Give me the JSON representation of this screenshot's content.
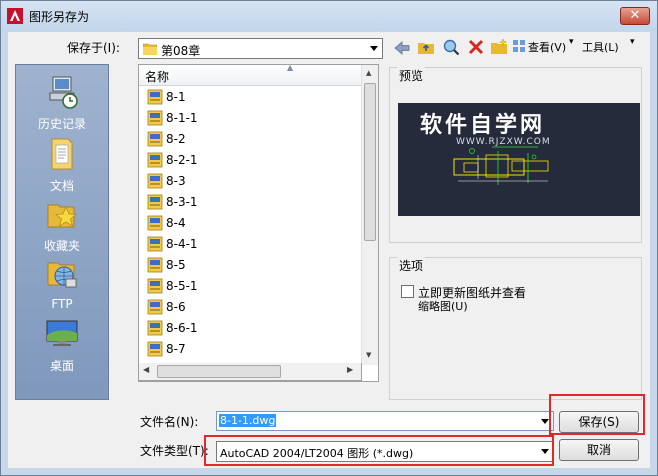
{
  "window": {
    "title": "图形另存为",
    "close_label": "✕"
  },
  "toolbar": {
    "save_in_label": "保存于(I):",
    "current_folder": "第08章",
    "view_label": "查看(V)",
    "tools_label": "工具(L)"
  },
  "places": [
    {
      "label": "历史记录",
      "icon": "history-icon"
    },
    {
      "label": "文档",
      "icon": "documents-icon"
    },
    {
      "label": "收藏夹",
      "icon": "favorites-icon"
    },
    {
      "label": "FTP",
      "icon": "ftp-icon"
    },
    {
      "label": "桌面",
      "icon": "desktop-icon"
    }
  ],
  "file_list": {
    "column_header": "名称",
    "items": [
      "8-1",
      "8-1-1",
      "8-2",
      "8-2-1",
      "8-3",
      "8-3-1",
      "8-4",
      "8-4-1",
      "8-5",
      "8-5-1",
      "8-6",
      "8-6-1",
      "8-7"
    ]
  },
  "preview": {
    "label": "预览",
    "watermark_title": "软件自学网",
    "watermark_url": "WWW.RJZXW.COM"
  },
  "options": {
    "label": "选项",
    "checkbox_line1": "立即更新图纸并查看",
    "checkbox_line2": "缩略图(U)",
    "checked": false
  },
  "filename": {
    "label": "文件名(N):",
    "value": "8-1-1.dwg"
  },
  "filetype": {
    "label": "文件类型(T):",
    "value": "AutoCAD 2004/LT2004 图形 (*.dwg)"
  },
  "buttons": {
    "save": "保存(S)",
    "cancel": "取消"
  },
  "colors": {
    "accent_red": "#e0282d",
    "titlebar": "#c6d7ea",
    "selection": "#3399ff"
  }
}
